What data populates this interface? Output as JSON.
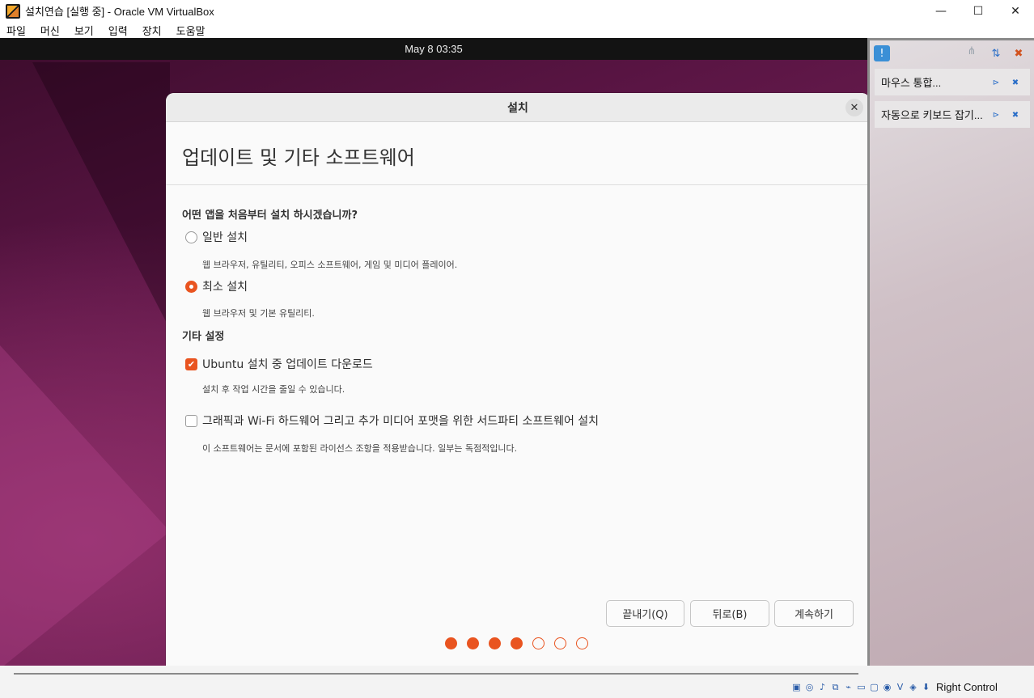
{
  "window": {
    "title": "설치연습 [실행 중] - Oracle VM VirtualBox",
    "minimize": "—",
    "maximize": "☐",
    "close": "✕"
  },
  "menubar": {
    "items": [
      "파일",
      "머신",
      "보기",
      "입력",
      "장치",
      "도움말"
    ]
  },
  "guest": {
    "clock": "May 8  03:35"
  },
  "installer": {
    "dialog_title": "설치",
    "close_glyph": "✕",
    "heading": "업데이트 및 기타 소프트웨어",
    "question": "어떤 앱을 처음부터 설치 하시겠습니까?",
    "normal_label": "일반 설치",
    "normal_desc": "웹 브라우저, 유틸리티, 오피스  소프트웨어, 게임 및 미디어 플레이어.",
    "minimal_label": "최소 설치",
    "minimal_desc": "웹 브라우저 및 기본 유틸리티.",
    "selected_install": "최소 설치",
    "other_settings": "기타 설정",
    "updates_label": "Ubuntu 설치 중 업데이트 다운로드",
    "updates_desc": "설치 후 작업 시간을 줄일 수 있습니다.",
    "updates_checked": true,
    "thirdparty_label": "그래픽과 Wi-Fi 하드웨어 그리고 추가 미디어 포맷을 위한 서드파티 소프트웨어 설치",
    "thirdparty_desc": "이 소프트웨어는 문서에 포함된 라이선스 조항을 적용받습니다. 일부는 독점적입니다.",
    "thirdparty_checked": false,
    "quit_button": "끝내기(Q)",
    "back_button": "뒤로(B)",
    "continue_button": "계속하기",
    "progress_total_steps": 7,
    "progress_current_step": 4,
    "accent": "#e95420"
  },
  "notifications": {
    "items": [
      "마우스 통합...",
      "자동으로 키보드 잡기..."
    ]
  },
  "statusbar": {
    "host_key": "Right Control",
    "icons": [
      "hard-disk-icon",
      "optical-drive-icon",
      "audio-icon",
      "network-icon",
      "usb-icon",
      "shared-folder-icon",
      "display-icon",
      "recording-icon",
      "virtualization-icon",
      "mouse-integration-icon",
      "keyboard-capture-icon"
    ]
  }
}
